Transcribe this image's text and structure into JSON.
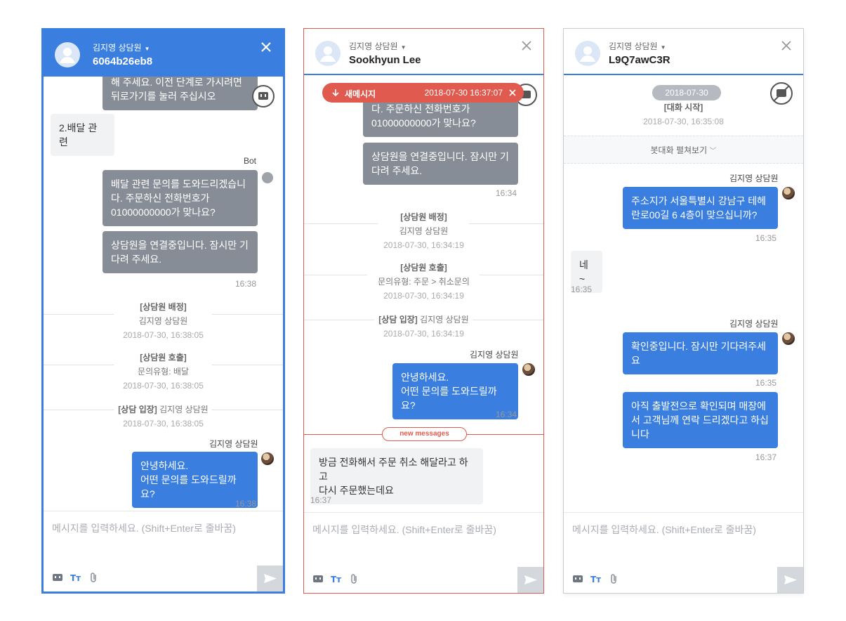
{
  "composer_placeholder": "메시지를 입력하세요. (Shift+Enter로 줄바꿈)",
  "panels": [
    {
      "agent_label": "김지영 상담원",
      "customer_id": "6064b26eb8",
      "messages": {
        "bot_top": "해 주세요. 이전 단계로 가시려면\n뒤로가기를 눌러 주십시오",
        "user_choice": "2.배달 관련",
        "bot_sender": "Bot",
        "bot_reply_1": "배달 관련 문의를 도와드리겠습니\n다. 주문하신 전화번호가\n01000000000가 맞나요?",
        "bot_reply_2": "상담원을 연결중입니다. 잠시만 기\n다려 주세요.",
        "bot_time": "16:38",
        "sys_assign_title": "[상담원 배정]",
        "sys_assign_agent": "김지영 상담원",
        "sys_assign_ts": "2018-07-30, 16:38:05",
        "sys_call_title": "[상담원 호출]",
        "sys_call_detail": "문의유형: 배달",
        "sys_call_ts": "2018-07-30, 16:38:05",
        "sys_enter_title": "[상담 입장]",
        "sys_enter_agent": "김지영 상담원",
        "sys_enter_ts": "2018-07-30, 16:38:05",
        "agent_sender": "김지영 상담원",
        "agent_msg": "안녕하세요.\n어떤 문의를 도와드릴까요?",
        "agent_time": "16:38"
      }
    },
    {
      "agent_label": "김지영 상담원",
      "customer_id": "Sookhyun Lee",
      "toast": {
        "label": "새메시지",
        "datetime": "2018-07-30  16:37:07"
      },
      "messages": {
        "bot_reply_1": "다. 주문하신 전화번호가\n01000000000가 맞나요?",
        "bot_reply_2": "상담원을 연결중입니다. 잠시만 기\n다려 주세요.",
        "bot_time": "16:34",
        "sys_assign_title": "[상담원 배정]",
        "sys_assign_agent": "김지영 상담원",
        "sys_assign_ts": "2018-07-30, 16:34:19",
        "sys_call_title": "[상담원 호출]",
        "sys_call_detail": "문의유형: 주문 > 취소문의",
        "sys_call_ts": "2018-07-30, 16:34:19",
        "sys_enter_title": "[상담 입장]",
        "sys_enter_agent": "김지영 상담원",
        "sys_enter_ts": "2018-07-30, 16:34:19",
        "agent_sender": "김지영 상담원",
        "agent_msg": "안녕하세요.\n어떤 문의를 도와드릴까요?",
        "agent_time": "16:34",
        "new_messages": "new messages",
        "user_msg": "방금 전화해서 주문 취소 해달라고 하고\n다시 주문했는데요",
        "user_time": "16:37"
      }
    },
    {
      "agent_label": "김지영 상담원",
      "customer_id": "L9Q7awC3R",
      "messages": {
        "date_pill": "2018-07-30",
        "sys_start_title": "[대화 시작]",
        "sys_start_ts": "2018-07-30, 16:35:08",
        "expand_bot": "봇대화 펼쳐보기",
        "agent_sender_1": "김지영 상담원",
        "agent_msg_1": "주소지가 서울특별시 강남구 테헤\n란로00길 6 4층이 맞으십니까?",
        "agent_time_1": "16:35",
        "user_msg": "네~",
        "user_time": "16:35",
        "agent_sender_2": "김지영 상담원",
        "agent_msg_2": "확인중입니다. 잠시만 기다려주세\n요",
        "agent_time_2": "16:35",
        "agent_msg_3": "아직 출발전으로 확인되며 매장에\n서 고객님께 연락 드리겠다고 하십\n니다",
        "agent_time_3": "16:37"
      }
    }
  ],
  "colors": {
    "accent": "#3a7fe0",
    "alert": "#e05a4f",
    "bot_bubble": "#878d96",
    "user_bubble": "#f1f2f4"
  }
}
